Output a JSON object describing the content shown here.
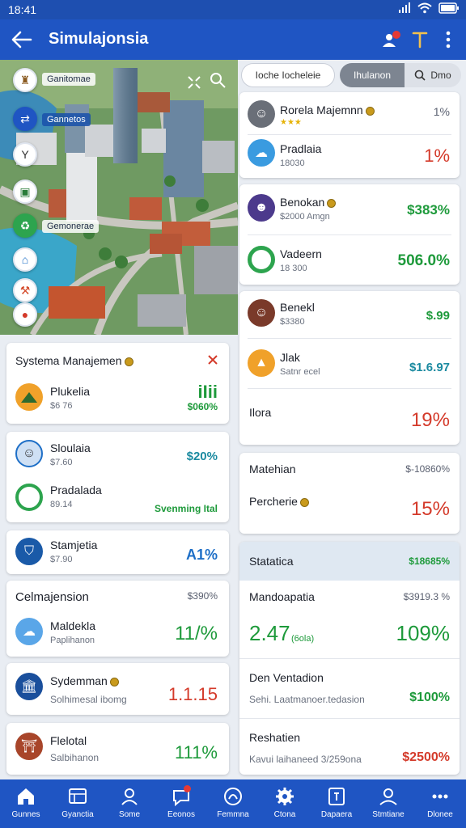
{
  "status_bar": {
    "time": "18:41"
  },
  "app_bar": {
    "title": "Simulajonsia"
  },
  "map": {
    "labels": [
      "Ganitomae",
      "Gannetos",
      "Gemonerae"
    ]
  },
  "tabs": [
    {
      "label": "Ioche Iocheleie",
      "state": "inactive"
    },
    {
      "label": "Ihulanon",
      "state": "active"
    },
    {
      "label": "Dmo",
      "state": "inactive"
    }
  ],
  "left_cards": {
    "system": {
      "title": "Systema Manajemen",
      "row1": {
        "name": "Plukelia",
        "sub": "$6 76",
        "value": "iIii",
        "value2": "$060%"
      }
    },
    "card2": {
      "row1": {
        "name": "Sloulaia",
        "sub": "$7.60",
        "value": "$20%"
      },
      "row2": {
        "name": "Pradalada",
        "sub": "89.14",
        "value": "Svenming Ital"
      }
    },
    "card3": {
      "name": "Stamjetia",
      "sub": "$7.90",
      "value": "A1%"
    },
    "card4": {
      "header": "Celmajension",
      "header_value": "$390%",
      "row1": {
        "name": "Maldekla",
        "sub": "Paplihanon",
        "value": "11/%"
      }
    },
    "card5": {
      "name": "Sydemman",
      "sub": "Solhimesal ibomg",
      "value": "1.1.15"
    },
    "card6": {
      "name": "Flelotal",
      "sub": "Salbihanon",
      "value": "111%"
    }
  },
  "right_cards": {
    "list1": [
      {
        "name": "Rorela Majemnn",
        "sub": "",
        "value": "1%",
        "value_class": "gray"
      },
      {
        "name": "Pradlaia",
        "sub": "18030",
        "value": "1%",
        "value_class": "red"
      }
    ],
    "list2": [
      {
        "name": "Benokan",
        "sub": "$2000 Amgn",
        "value": "$383%",
        "value_class": "green"
      },
      {
        "name": "Vadeern",
        "sub": "18 300",
        "value": "506.0%",
        "value_class": "green"
      }
    ],
    "list3": [
      {
        "name": "Benekl",
        "sub": "$3380",
        "value": "$.99",
        "value_class": "green"
      },
      {
        "name": "Jlak",
        "sub": "Satnr ecel",
        "value": "$1.6.97",
        "value_class": "teal"
      },
      {
        "name": "Ilora",
        "sub": "",
        "value": "19%",
        "value_class": "red"
      }
    ],
    "stats1": {
      "row1": {
        "name": "Matehian",
        "value": "$-10860%"
      },
      "row2": {
        "name": "Percherie",
        "value": "15%"
      }
    },
    "stats2": {
      "header": "Statatica",
      "header_value": "$18685%",
      "row1": {
        "name": "Mandoapatia",
        "value_small": "$3919.3 %",
        "big": "2.47",
        "big_sub": "(6ola)",
        "value": "109%"
      },
      "row2": {
        "name": "Den Ventadion",
        "sub": "Sehi. Laatmanoer.tedasion",
        "value": "$100%"
      },
      "row3": {
        "name": "Reshatien",
        "sub": "Kavui laihaneed 3/259ona",
        "value": "$2500%"
      }
    }
  },
  "bottom_nav": [
    {
      "label": "Gunnes",
      "icon": "home-icon"
    },
    {
      "label": "Gyanctia",
      "icon": "map-icon"
    },
    {
      "label": "Some",
      "icon": "user-icon"
    },
    {
      "label": "Eeonos",
      "icon": "chat-icon"
    },
    {
      "label": "Femmna",
      "icon": "leaf-icon"
    },
    {
      "label": "Ctona",
      "icon": "gear-icon"
    },
    {
      "label": "Dapaera",
      "icon": "task-icon"
    },
    {
      "label": "Stmtiane",
      "icon": "people-icon"
    },
    {
      "label": "Dlonee",
      "icon": "more-icon"
    }
  ]
}
